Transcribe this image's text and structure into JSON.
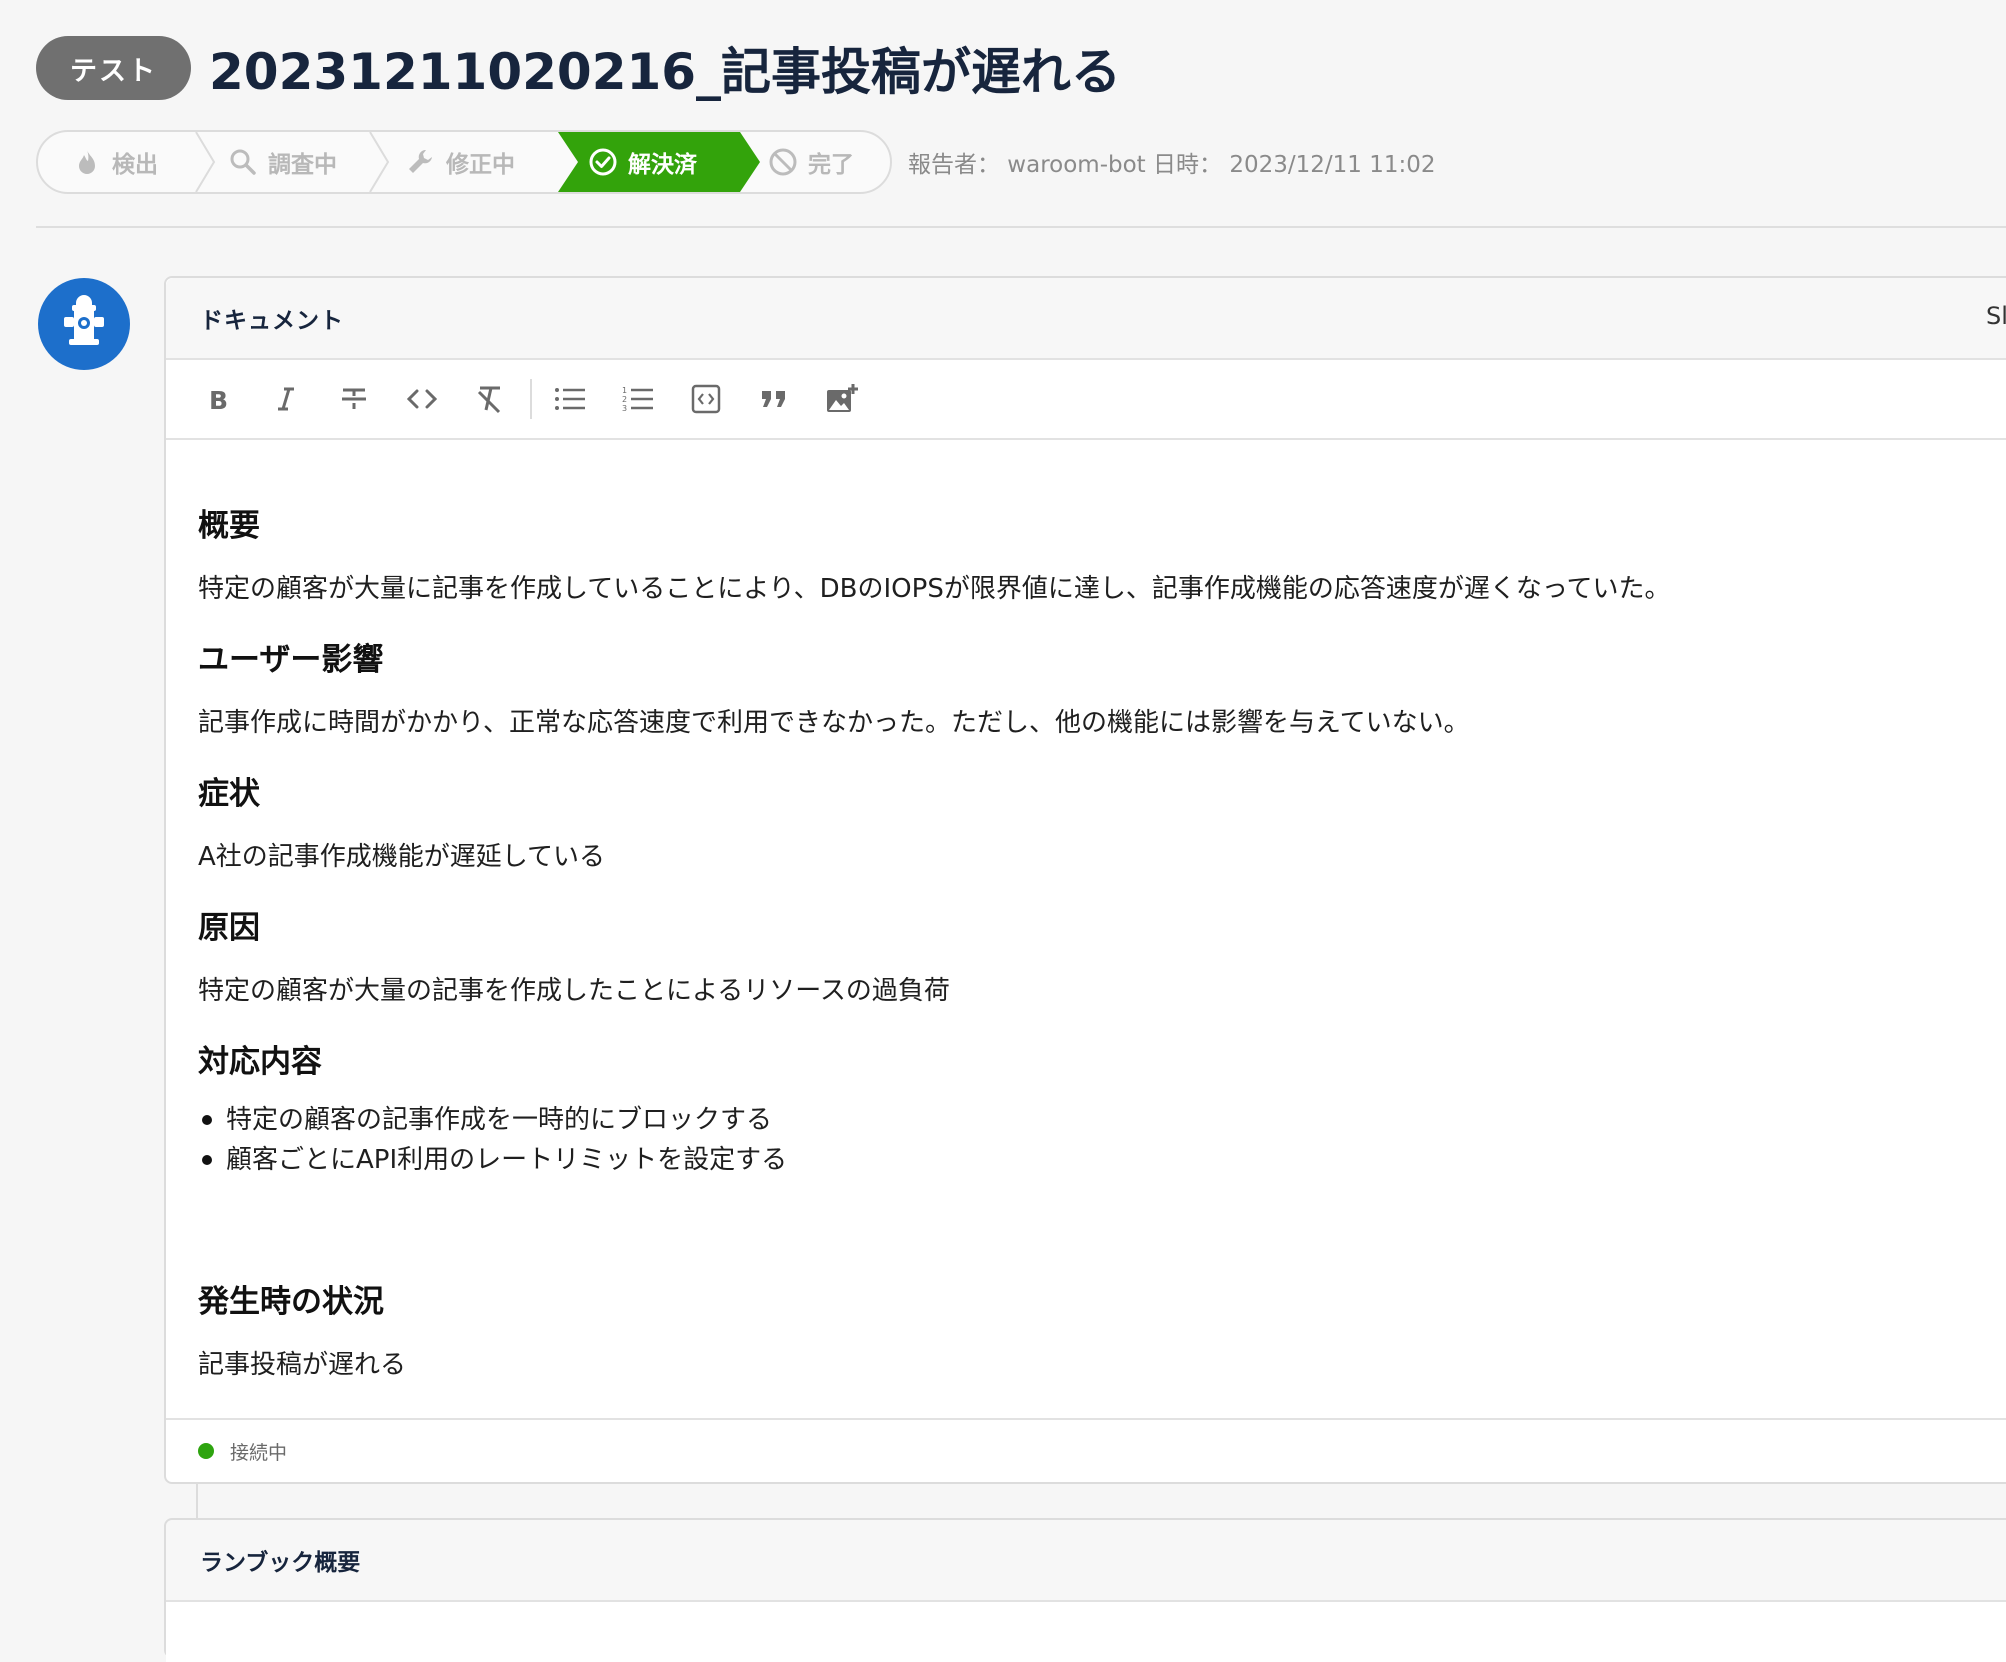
{
  "header": {
    "tag": "テスト",
    "title": "20231211020216_記事投稿が遅れる",
    "reporter_meta": "報告者： waroom-bot 日時： 2023/12/11 11:02"
  },
  "status_steps": [
    {
      "label": "検出",
      "icon": "fire-icon",
      "active": false
    },
    {
      "label": "調査中",
      "icon": "search-icon",
      "active": false
    },
    {
      "label": "修正中",
      "icon": "wrench-icon",
      "active": false
    },
    {
      "label": "解決済",
      "icon": "check-circle-icon",
      "active": true
    },
    {
      "label": "完了",
      "icon": "prohibited-icon",
      "active": false
    }
  ],
  "colors": {
    "active_step": "#33a30b",
    "avatar": "#1d6fcb",
    "connection": "#2ea40f",
    "title": "#17253d"
  },
  "document": {
    "header_title": "ドキュメント",
    "header_right": "Sl",
    "toolbar": [
      "bold-icon",
      "italic-icon",
      "strikethrough-icon",
      "code-icon",
      "clear-format-icon",
      "bullet-list-icon",
      "numbered-list-icon",
      "code-block-icon",
      "quote-icon",
      "image-add-icon"
    ],
    "sections": {
      "summary_heading": "概要",
      "summary_text": "特定の顧客が大量に記事を作成していることにより、DBのIOPSが限界値に達し、記事作成機能の応答速度が遅くなっていた。",
      "impact_heading": "ユーザー影響",
      "impact_text": "記事作成に時間がかかり、正常な応答速度で利用できなかった。ただし、他の機能には影響を与えていない。",
      "symptom_heading": "症状",
      "symptom_text": "A社の記事作成機能が遅延している",
      "cause_heading": "原因",
      "cause_text": "特定の顧客が大量の記事を作成したことによるリソースの過負荷",
      "response_heading": "対応内容",
      "response_items": [
        "特定の顧客の記事作成を一時的にブロックする",
        "顧客ごとにAPI利用のレートリミットを設定する"
      ],
      "situation_heading": "発生時の状況",
      "situation_text": "記事投稿が遅れる"
    },
    "connection_status": "接続中"
  },
  "runbook": {
    "title": "ランブック概要"
  }
}
